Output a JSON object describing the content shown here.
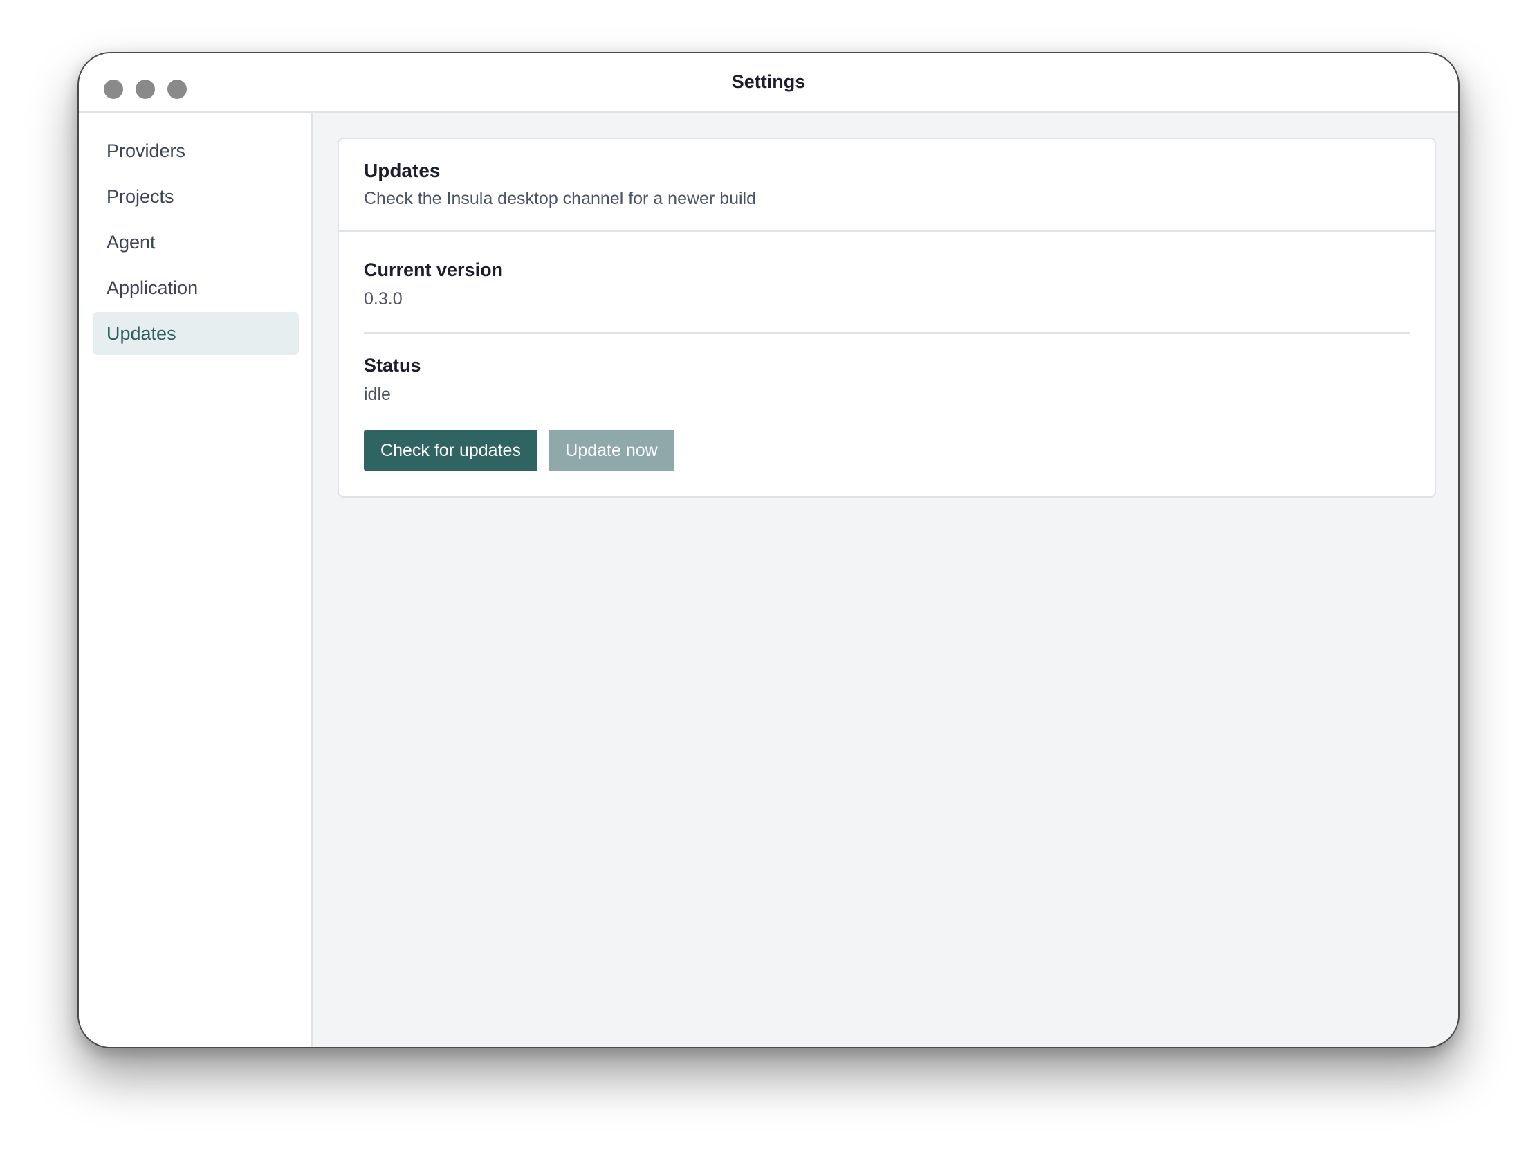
{
  "window": {
    "title": "Settings"
  },
  "sidebar": {
    "items": [
      {
        "label": "Providers",
        "active": false
      },
      {
        "label": "Projects",
        "active": false
      },
      {
        "label": "Agent",
        "active": false
      },
      {
        "label": "Application",
        "active": false
      },
      {
        "label": "Updates",
        "active": true
      }
    ]
  },
  "updates_card": {
    "title": "Updates",
    "subtitle": "Check the Insula desktop channel for a newer build",
    "current_version_label": "Current version",
    "current_version_value": "0.3.0",
    "status_label": "Status",
    "status_value": "idle",
    "check_button_label": "Check for updates",
    "update_button_label": "Update now"
  },
  "colors": {
    "accent": "#2f6463",
    "accent_disabled": "#8fa9aa",
    "active_nav_bg": "#e6eef0"
  }
}
